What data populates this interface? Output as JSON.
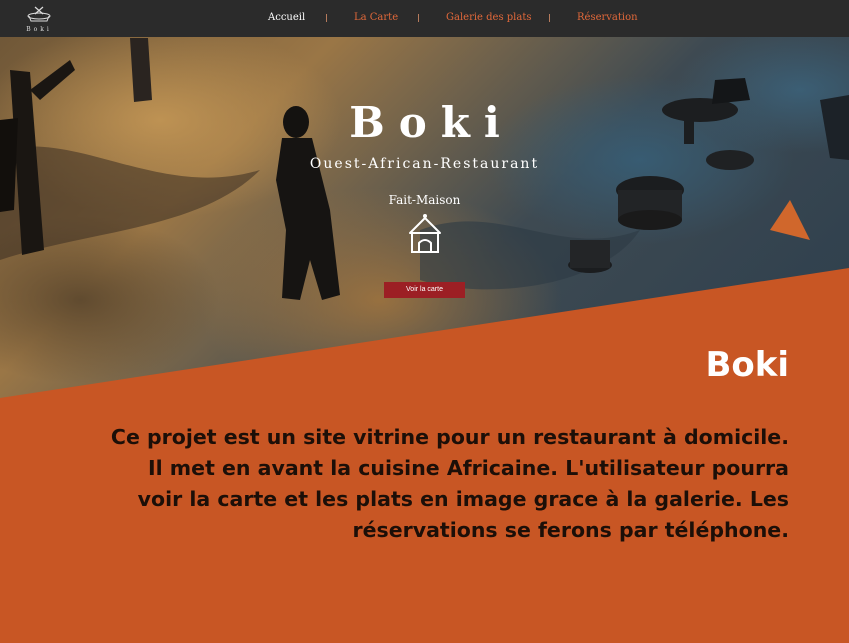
{
  "nav": {
    "logo_text": "Boki",
    "links": [
      {
        "label": "Accueil",
        "active": true
      },
      {
        "label": "La Carte",
        "active": false
      },
      {
        "label": "Galerie des plats",
        "active": false
      },
      {
        "label": "Réservation",
        "active": false
      }
    ]
  },
  "hero": {
    "title": "Boki",
    "subtitle": "Ouest-African-Restaurant",
    "tagline": "Fait-Maison",
    "cta_label": "Voir la carte"
  },
  "info": {
    "title": "Boki",
    "description": "Ce projet est un site vitrine pour un restaurant à domicile. Il met en avant la cuisine Africaine. L'utilisateur pourra voir la carte et les plats en image grace à la galerie. Les réservations se ferons par téléphone."
  },
  "colors": {
    "nav_bg": "#2b2b2b",
    "nav_link": "#e1683a",
    "accent_orange": "#c85624",
    "cta_red": "#9c1f24"
  }
}
